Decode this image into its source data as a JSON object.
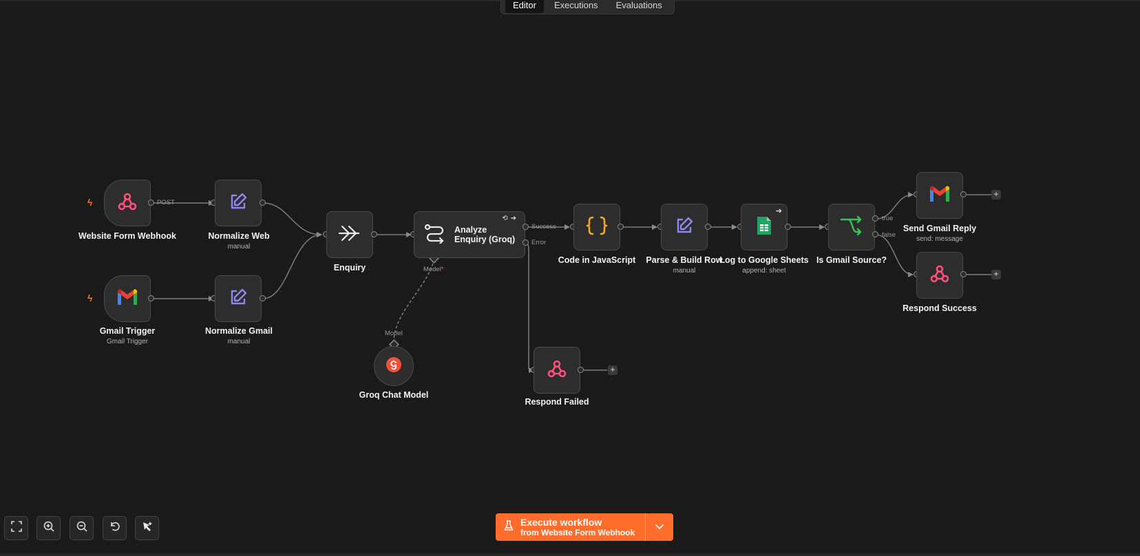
{
  "tabs": [
    {
      "label": "Editor",
      "active": true
    },
    {
      "label": "Executions",
      "active": false
    },
    {
      "label": "Evaluations",
      "active": false
    }
  ],
  "nodes": {
    "website_form_webhook": {
      "title": "Website Form Webhook",
      "icon": "webhook-icon"
    },
    "normalize_web": {
      "title": "Normalize Web",
      "subtitle": "manual",
      "icon": "edit-icon"
    },
    "gmail_trigger": {
      "title": "Gmail Trigger",
      "subtitle": "Gmail Trigger",
      "icon": "gmail-icon"
    },
    "normalize_gmail": {
      "title": "Normalize Gmail",
      "subtitle": "manual",
      "icon": "edit-icon"
    },
    "enquiry": {
      "title": "Enquiry",
      "icon": "merge-arrows-icon"
    },
    "analyze_enquiry": {
      "title": "Analyze Enquiry (Groq)",
      "icon": "route-icon"
    },
    "groq_chat_model": {
      "title": "Groq Chat Model",
      "icon": "groq-icon"
    },
    "code_in_javascript": {
      "title": "Code in JavaScript",
      "icon": "curly-braces-icon"
    },
    "parse_build_row": {
      "title": "Parse & Build Row",
      "subtitle": "manual",
      "icon": "edit-icon"
    },
    "log_to_google_sheets": {
      "title": "Log to Google Sheets",
      "subtitle": "append: sheet",
      "icon": "google-sheets-icon"
    },
    "is_gmail_source": {
      "title": "Is Gmail Source?",
      "icon": "if-branch-icon"
    },
    "send_gmail_reply": {
      "title": "Send Gmail Reply",
      "subtitle": "send: message",
      "icon": "gmail-icon"
    },
    "respond_success": {
      "title": "Respond Success",
      "icon": "webhook-icon"
    },
    "respond_failed": {
      "title": "Respond Failed",
      "icon": "webhook-icon"
    }
  },
  "edge_labels": {
    "post": "POST",
    "success": "Success",
    "error": "Error",
    "model_out": "Model",
    "model_req": "*",
    "model_in": "Model",
    "true": "true",
    "false": "false"
  },
  "add_symbol": "+",
  "execute": {
    "title": "Execute workflow",
    "subtitle": "from Website Form Webhook",
    "icon": "flask-icon",
    "dropdown_icon": "chevron-down-icon"
  },
  "controls": [
    "fit-view-icon",
    "zoom-in-icon",
    "zoom-out-icon",
    "undo-icon",
    "tidy-up-icon"
  ],
  "colors": {
    "accent": "#ff6d2d",
    "canvas": "#1a1a1a",
    "webhook": "#ff4f7d",
    "edit": "#8f87f1",
    "braces": "#f5a623",
    "sheets": "#21a464",
    "if_branch": "#35c759",
    "groq": "#f55036"
  }
}
